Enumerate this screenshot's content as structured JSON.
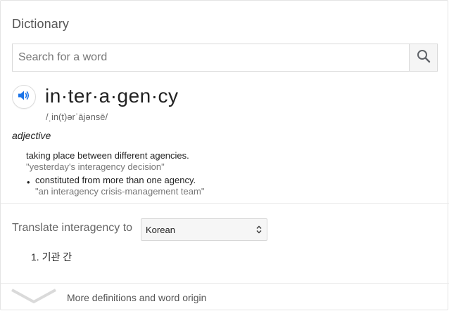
{
  "panel": {
    "title": "Dictionary"
  },
  "search": {
    "placeholder": "Search for a word",
    "value": "",
    "icon": "magnifier-icon"
  },
  "entry": {
    "headword": "in·ter·a·gen·cy",
    "phonetic": "/ˌin(t)ərˈājənsē/",
    "part_of_speech": "adjective",
    "pronounce_icon": "speaker-icon",
    "accent_color": "#1a73e8",
    "definitions": [
      {
        "text": "taking place between different agencies.",
        "example": "\"yesterday's interagency decision\""
      },
      {
        "bullet": "•",
        "text": "constituted from more than one agency.",
        "example": "\"an interagency crisis-management team\""
      }
    ]
  },
  "translate": {
    "label": "Translate interagency to",
    "selected_language": "Korean",
    "results": [
      {
        "text": "1. 기관 간"
      }
    ]
  },
  "footer": {
    "more_label": "More definitions and word origin",
    "expand_icon": "chevron-down-icon"
  }
}
